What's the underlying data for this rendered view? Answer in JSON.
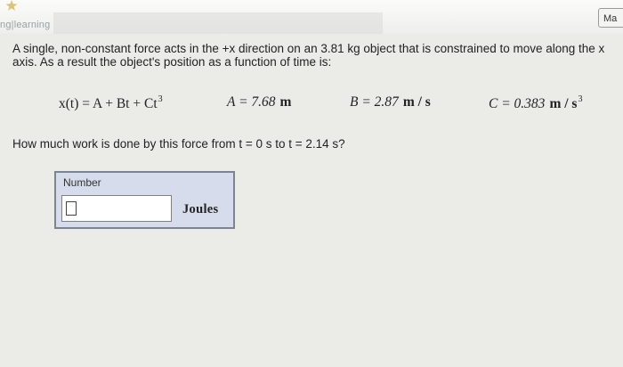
{
  "header": {
    "brand": "ng|learning",
    "corner_button": "Ma"
  },
  "problem": {
    "text": "A single, non-constant force acts in the +x direction on an 3.81 kg object that is constrained to move along the x axis. As a result the object's position as a function of time is:"
  },
  "formula": {
    "equation_lhs": "x(t) = A + Bt + Ct",
    "equation_exp": "3",
    "A_label": "A = 7.68",
    "A_unit": "m",
    "B_label": "B = 2.87",
    "B_unit": "m / s",
    "C_label": "C = 0.383",
    "C_unit": "m / s",
    "C_unit_exp": "3"
  },
  "question": {
    "text": "How much work is done by this force from t = 0 s to t = 2.14 s?"
  },
  "answer": {
    "label": "Number",
    "value": "",
    "unit": "Joules"
  }
}
